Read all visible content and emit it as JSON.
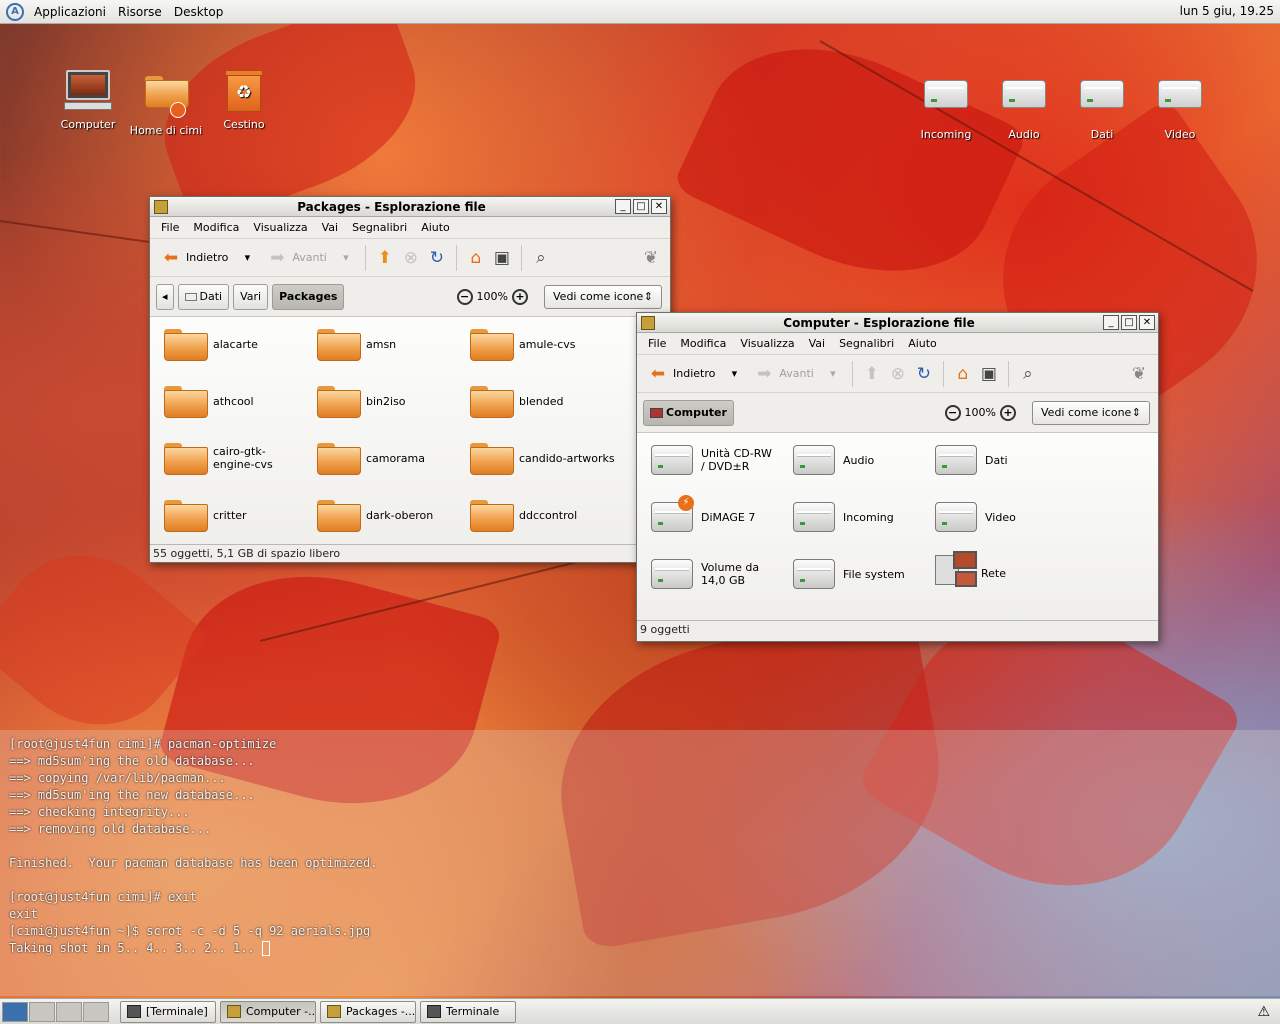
{
  "top_panel": {
    "menus": [
      "Applicazioni",
      "Risorse",
      "Desktop"
    ],
    "clock": "lun  5 giu, 19.25"
  },
  "desktop_icons": [
    {
      "label": "Computer",
      "icon": "computer-icon"
    },
    {
      "label": "Home di cimi",
      "icon": "home-folder-icon"
    },
    {
      "label": "Cestino",
      "icon": "trash-icon"
    },
    {
      "label": "Incoming",
      "icon": "drive-icon"
    },
    {
      "label": "Audio",
      "icon": "drive-icon"
    },
    {
      "label": "Dati",
      "icon": "drive-icon"
    },
    {
      "label": "Video",
      "icon": "drive-icon"
    }
  ],
  "packages_window": {
    "title": "Packages - Esplorazione file",
    "menus": [
      "File",
      "Modifica",
      "Visualizza",
      "Vai",
      "Segnalibri",
      "Aiuto"
    ],
    "back_label": "Indietro",
    "forward_label": "Avanti",
    "breadcrumbs": [
      "Dati",
      "Vari",
      "Packages"
    ],
    "zoom": "100%",
    "view_mode": "Vedi come icone",
    "items": [
      "alacarte",
      "amsn",
      "amule-cvs",
      "athcool",
      "bin2iso",
      "blended",
      "cairo-gtk-engine-cvs",
      "camorama",
      "candido-artworks",
      "critter",
      "dark-oberon",
      "ddccontrol"
    ],
    "status": "55 oggetti, 5,1 GB di spazio libero"
  },
  "computer_window": {
    "title": "Computer - Esplorazione file",
    "menus": [
      "File",
      "Modifica",
      "Visualizza",
      "Vai",
      "Segnalibri",
      "Aiuto"
    ],
    "back_label": "Indietro",
    "forward_label": "Avanti",
    "breadcrumb": "Computer",
    "zoom": "100%",
    "view_mode": "Vedi come icone",
    "items": [
      "Unità CD-RW / DVD±R",
      "Audio",
      "Dati",
      "DiMAGE 7",
      "Incoming",
      "Video",
      "Volume da 14,0 GB",
      "File system",
      "Rete"
    ],
    "status": "9 oggetti"
  },
  "terminal": {
    "lines": [
      "[root@just4fun cimi]# pacman-optimize",
      "==> md5sum'ing the old database...",
      "==> copying /var/lib/pacman...",
      "==> md5sum'ing the new database...",
      "==> checking integrity...",
      "==> removing old database...",
      "",
      "Finished.  Your pacman database has been optimized.",
      "",
      "[root@just4fun cimi]# exit",
      "exit",
      "[cimi@just4fun ~]$ scrot -c -d 5 -q 92 aerials.jpg",
      "Taking shot in 5.. 4.. 3.. 2.. 1.. "
    ]
  },
  "taskbar": {
    "tasks": [
      "[Terminale]",
      "Computer -...",
      "Packages -...",
      "Terminale"
    ]
  }
}
